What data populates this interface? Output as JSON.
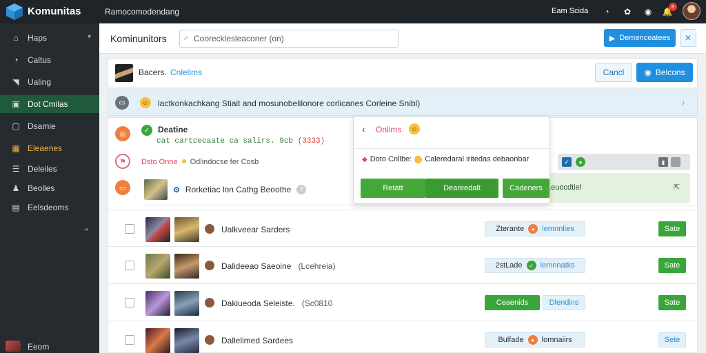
{
  "topbar": {
    "app_name": "Komunitas",
    "title": "Ramocomodendang",
    "user_name": "Eam Scida",
    "notification_count": "8"
  },
  "sidebar": {
    "items": [
      {
        "label": "Haps",
        "icon": "home-icon"
      },
      {
        "label": "Caltus",
        "icon": "clock-icon"
      },
      {
        "label": "Ualing",
        "icon": "megaphone-icon"
      },
      {
        "label": "Dot Cmilas",
        "icon": "cube-icon",
        "active": true
      },
      {
        "label": "Dsamie",
        "icon": "chat-icon"
      },
      {
        "label": "Eleaenes",
        "icon": "grid-icon",
        "warn": true
      },
      {
        "label": "Deleiles",
        "icon": "list-icon"
      },
      {
        "label": "Beolles",
        "icon": "users-icon"
      },
      {
        "label": "Eelsdeoms",
        "icon": "folder-icon"
      }
    ],
    "bottom_label": "Eeom"
  },
  "header": {
    "page_title": "Kominunitors",
    "search_value": "Coorecklesleaconer (on)",
    "primary_button": "Demenceatees"
  },
  "user_card": {
    "name": "Bacers.",
    "status": "Cnlelims",
    "outline_button": "Cancl",
    "blue_button": "Belcons"
  },
  "banner": {
    "text": "lactkonkachkang Stiait and mosunobelilonore corlicanes Corleine Snibl)"
  },
  "feed": {
    "title": "Deatine",
    "code_prefix": "cat cartcecaate ca salirs. 9cb (",
    "code_red": "3333",
    "code_suffix": ")",
    "alert_label": "Dsto Onne",
    "alert_text": "Odlindocse fer Cosb",
    "game_text": "Rorketiac lon Cathg Beoothe",
    "green_text": "Leuocdtiel"
  },
  "popup": {
    "title": "Onlims",
    "detail_prefix": "Doto Cnllbe:",
    "detail_text": "Caleredaral iritedas debaonbar",
    "btn1": "Retatt",
    "btn2": "Deareedalt",
    "btn3": "Cadeners"
  },
  "rows": [
    {
      "name": "Ualkveear Sarders",
      "paren": "",
      "pill_left": "Zterante",
      "pill_right": "lemnnlies",
      "dot": "orange",
      "action": "Sate",
      "action_style": "green"
    },
    {
      "name": "Dalideeao Saeoine",
      "paren": "(Lcehreia)",
      "pill_left": "2stLade",
      "pill_right": "lemnnatks",
      "dot": "green",
      "action": "Sate",
      "action_style": "green"
    },
    {
      "name": "Dakiueoda Seleiste.",
      "paren": "(Sc0810",
      "pill_left": "Ceaenids",
      "pill_right": "Dlendins",
      "dot": "none",
      "action": "Sate",
      "action_style": "green"
    },
    {
      "name": "Dallelimed Sardees",
      "paren": "",
      "pill_left": "Bulfade",
      "pill_right": "lomnaiirs",
      "dot": "orange",
      "action": "Sete",
      "action_style": "light"
    }
  ]
}
